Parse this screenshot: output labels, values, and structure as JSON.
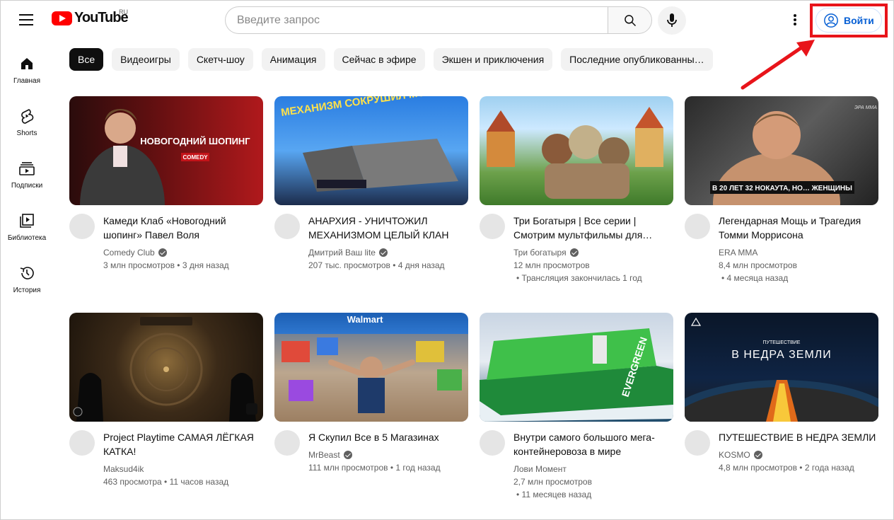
{
  "header": {
    "logo_text": "YouTube",
    "region": "RU",
    "search_placeholder": "Введите запрос",
    "signin_label": "Войти"
  },
  "colors": {
    "brand_red": "#ff0000",
    "signin_blue": "#065fd4",
    "highlight_red": "#e8141a"
  },
  "sidebar": {
    "items": [
      {
        "label": "Главная",
        "icon": "home-icon"
      },
      {
        "label": "Shorts",
        "icon": "shorts-icon"
      },
      {
        "label": "Подписки",
        "icon": "subscriptions-icon"
      },
      {
        "label": "Библиотека",
        "icon": "library-icon"
      },
      {
        "label": "История",
        "icon": "history-icon"
      }
    ]
  },
  "chips": [
    "Все",
    "Видеоигры",
    "Скетч-шоу",
    "Анимация",
    "Сейчас в эфире",
    "Экшен и приключения",
    "Последние опубликованны…"
  ],
  "videos": [
    {
      "title": "Камеди Клаб «Новогодний шопинг» Павел Воля",
      "channel": "Comedy Club",
      "verified": true,
      "stats": "3 млн просмотров • 3 дня назад",
      "stats2": "",
      "thumb_text": "НОВОГОДНИЙ ШОПИНГ",
      "thumb_text2": "COMEDY"
    },
    {
      "title": "АНАРХИЯ - УНИЧТОЖИЛ МЕХАНИЗМОМ ЦЕЛЫЙ КЛАН",
      "channel": "Дмитрий Ваш lite",
      "verified": true,
      "stats": "207 тыс. просмотров • 4 дня назад",
      "stats2": "",
      "thumb_text": "МЕХАНИЗМ СОКРУШИЛ МОГУЩЕСТВЕННЫЙ КЛАН",
      "thumb_text2": ""
    },
    {
      "title": "Три Богатыря | Все серии | Смотрим мультфильмы для…",
      "channel": "Три богатыря",
      "verified": true,
      "stats": "12 млн просмотров",
      "stats2": "• Трансляция закончилась 1 год",
      "thumb_text": "",
      "thumb_text2": ""
    },
    {
      "title": "Легендарная Мощь и Трагедия Томми Моррисона",
      "channel": "ERA MMA",
      "verified": false,
      "stats": "8,4 млн просмотров",
      "stats2": "• 4 месяца назад",
      "thumb_text": "В 20 ЛЕТ 32 НОКАУТА, НО… ЖЕНЩИНЫ",
      "thumb_text2": "ЭРА ММА"
    },
    {
      "title": "Project Playtime САМАЯ ЛЁГКАЯ КАТКА!",
      "channel": "Maksud4ik",
      "verified": false,
      "stats": "463 просмотра • 11 часов назад",
      "stats2": "",
      "thumb_text": "",
      "thumb_text2": ""
    },
    {
      "title": "Я Скупил Все в 5 Магазинах",
      "channel": "MrBeast",
      "verified": true,
      "stats": "111 млн просмотров • 1 год назад",
      "stats2": "",
      "thumb_text": "Walmart",
      "thumb_text2": ""
    },
    {
      "title": "Внутри самого большого мега-контейнеровоза в мире",
      "channel": "Лови Момент",
      "verified": false,
      "stats": "2,7 млн просмотров",
      "stats2": "• 11 месяцев назад",
      "thumb_text": "EVERGREEN",
      "thumb_text2": ""
    },
    {
      "title": "ПУТЕШЕСТВИЕ В НЕДРА ЗЕМЛИ",
      "channel": "KOSMO",
      "verified": true,
      "stats": "4,8 млн просмотров • 2 года назад",
      "stats2": "",
      "thumb_text": "ПУТЕШЕСТВИЕ",
      "thumb_text2": "В НЕДРА ЗЕМЛИ"
    }
  ]
}
